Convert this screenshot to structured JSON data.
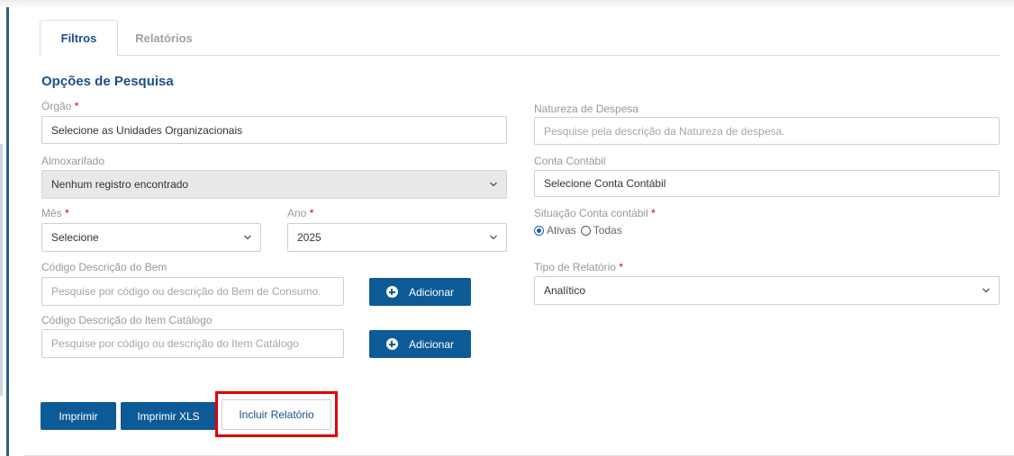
{
  "tabs": [
    {
      "label": "Filtros",
      "active": true
    },
    {
      "label": "Relatórios",
      "active": false
    }
  ],
  "section_title": "Opções de Pesquisa",
  "required_mark": "*",
  "orgao": {
    "label": "Órgão",
    "value": "Selecione as Unidades Organizacionais"
  },
  "almoxarifado": {
    "label": "Almoxarifado",
    "value": "Nenhum registro encontrado"
  },
  "mes": {
    "label": "Mês",
    "value": "Selecione"
  },
  "ano": {
    "label": "Ano",
    "value": "2025"
  },
  "codigo_bem": {
    "label": "Código Descrição do Bem",
    "placeholder": "Pesquise por código ou descrição do Bem de Consumo."
  },
  "codigo_item": {
    "label": "Código Descrição do Item Catálogo",
    "placeholder": "Pesquise por código ou descrição do Item Catálogo"
  },
  "adicionar_label": "Adicionar",
  "natureza": {
    "label": "Natureza de Despesa",
    "placeholder": "Pesquise pela descrição da Natureza de despesa."
  },
  "conta_contabil": {
    "label": "Conta Contábil",
    "value": "Selecione Conta Contábil"
  },
  "situacao": {
    "label": "Situação Conta contábil",
    "options": [
      {
        "label": "Ativas",
        "checked": true
      },
      {
        "label": "Todas",
        "checked": false
      }
    ]
  },
  "tipo_relatorio": {
    "label": "Tipo de Relatório",
    "value": "Analítico"
  },
  "buttons": {
    "imprimir": "Imprimir",
    "imprimir_xls": "Imprimir XLS",
    "incluir_relatorio": "Incluir Relatório"
  },
  "colors": {
    "primary": "#0d5b96",
    "title": "#1b4f86",
    "required": "#cc0000",
    "highlight": "#e00000"
  },
  "icons": {
    "select": "chevron-down-icon",
    "add": "plus-circle-icon"
  }
}
